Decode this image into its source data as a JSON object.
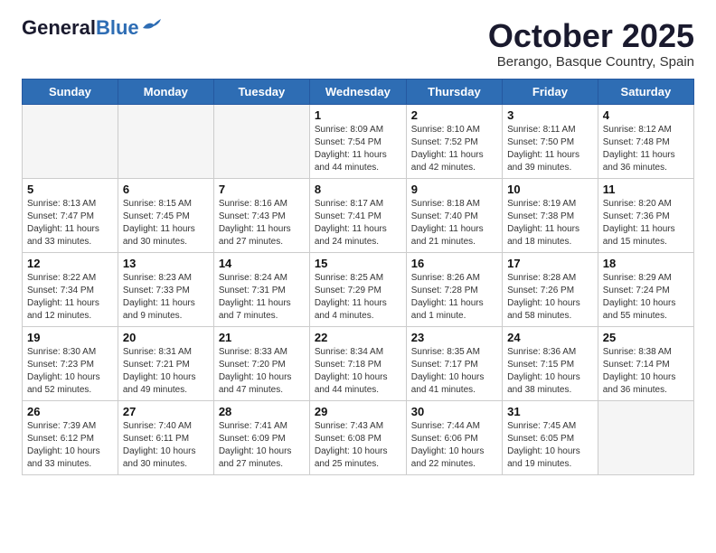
{
  "header": {
    "logo_line1": "General",
    "logo_line2": "Blue",
    "month": "October 2025",
    "location": "Berango, Basque Country, Spain"
  },
  "days_of_week": [
    "Sunday",
    "Monday",
    "Tuesday",
    "Wednesday",
    "Thursday",
    "Friday",
    "Saturday"
  ],
  "weeks": [
    [
      {
        "day": "",
        "info": ""
      },
      {
        "day": "",
        "info": ""
      },
      {
        "day": "",
        "info": ""
      },
      {
        "day": "1",
        "info": "Sunrise: 8:09 AM\nSunset: 7:54 PM\nDaylight: 11 hours\nand 44 minutes."
      },
      {
        "day": "2",
        "info": "Sunrise: 8:10 AM\nSunset: 7:52 PM\nDaylight: 11 hours\nand 42 minutes."
      },
      {
        "day": "3",
        "info": "Sunrise: 8:11 AM\nSunset: 7:50 PM\nDaylight: 11 hours\nand 39 minutes."
      },
      {
        "day": "4",
        "info": "Sunrise: 8:12 AM\nSunset: 7:48 PM\nDaylight: 11 hours\nand 36 minutes."
      }
    ],
    [
      {
        "day": "5",
        "info": "Sunrise: 8:13 AM\nSunset: 7:47 PM\nDaylight: 11 hours\nand 33 minutes."
      },
      {
        "day": "6",
        "info": "Sunrise: 8:15 AM\nSunset: 7:45 PM\nDaylight: 11 hours\nand 30 minutes."
      },
      {
        "day": "7",
        "info": "Sunrise: 8:16 AM\nSunset: 7:43 PM\nDaylight: 11 hours\nand 27 minutes."
      },
      {
        "day": "8",
        "info": "Sunrise: 8:17 AM\nSunset: 7:41 PM\nDaylight: 11 hours\nand 24 minutes."
      },
      {
        "day": "9",
        "info": "Sunrise: 8:18 AM\nSunset: 7:40 PM\nDaylight: 11 hours\nand 21 minutes."
      },
      {
        "day": "10",
        "info": "Sunrise: 8:19 AM\nSunset: 7:38 PM\nDaylight: 11 hours\nand 18 minutes."
      },
      {
        "day": "11",
        "info": "Sunrise: 8:20 AM\nSunset: 7:36 PM\nDaylight: 11 hours\nand 15 minutes."
      }
    ],
    [
      {
        "day": "12",
        "info": "Sunrise: 8:22 AM\nSunset: 7:34 PM\nDaylight: 11 hours\nand 12 minutes."
      },
      {
        "day": "13",
        "info": "Sunrise: 8:23 AM\nSunset: 7:33 PM\nDaylight: 11 hours\nand 9 minutes."
      },
      {
        "day": "14",
        "info": "Sunrise: 8:24 AM\nSunset: 7:31 PM\nDaylight: 11 hours\nand 7 minutes."
      },
      {
        "day": "15",
        "info": "Sunrise: 8:25 AM\nSunset: 7:29 PM\nDaylight: 11 hours\nand 4 minutes."
      },
      {
        "day": "16",
        "info": "Sunrise: 8:26 AM\nSunset: 7:28 PM\nDaylight: 11 hours\nand 1 minute."
      },
      {
        "day": "17",
        "info": "Sunrise: 8:28 AM\nSunset: 7:26 PM\nDaylight: 10 hours\nand 58 minutes."
      },
      {
        "day": "18",
        "info": "Sunrise: 8:29 AM\nSunset: 7:24 PM\nDaylight: 10 hours\nand 55 minutes."
      }
    ],
    [
      {
        "day": "19",
        "info": "Sunrise: 8:30 AM\nSunset: 7:23 PM\nDaylight: 10 hours\nand 52 minutes."
      },
      {
        "day": "20",
        "info": "Sunrise: 8:31 AM\nSunset: 7:21 PM\nDaylight: 10 hours\nand 49 minutes."
      },
      {
        "day": "21",
        "info": "Sunrise: 8:33 AM\nSunset: 7:20 PM\nDaylight: 10 hours\nand 47 minutes."
      },
      {
        "day": "22",
        "info": "Sunrise: 8:34 AM\nSunset: 7:18 PM\nDaylight: 10 hours\nand 44 minutes."
      },
      {
        "day": "23",
        "info": "Sunrise: 8:35 AM\nSunset: 7:17 PM\nDaylight: 10 hours\nand 41 minutes."
      },
      {
        "day": "24",
        "info": "Sunrise: 8:36 AM\nSunset: 7:15 PM\nDaylight: 10 hours\nand 38 minutes."
      },
      {
        "day": "25",
        "info": "Sunrise: 8:38 AM\nSunset: 7:14 PM\nDaylight: 10 hours\nand 36 minutes."
      }
    ],
    [
      {
        "day": "26",
        "info": "Sunrise: 7:39 AM\nSunset: 6:12 PM\nDaylight: 10 hours\nand 33 minutes."
      },
      {
        "day": "27",
        "info": "Sunrise: 7:40 AM\nSunset: 6:11 PM\nDaylight: 10 hours\nand 30 minutes."
      },
      {
        "day": "28",
        "info": "Sunrise: 7:41 AM\nSunset: 6:09 PM\nDaylight: 10 hours\nand 27 minutes."
      },
      {
        "day": "29",
        "info": "Sunrise: 7:43 AM\nSunset: 6:08 PM\nDaylight: 10 hours\nand 25 minutes."
      },
      {
        "day": "30",
        "info": "Sunrise: 7:44 AM\nSunset: 6:06 PM\nDaylight: 10 hours\nand 22 minutes."
      },
      {
        "day": "31",
        "info": "Sunrise: 7:45 AM\nSunset: 6:05 PM\nDaylight: 10 hours\nand 19 minutes."
      },
      {
        "day": "",
        "info": ""
      }
    ]
  ]
}
